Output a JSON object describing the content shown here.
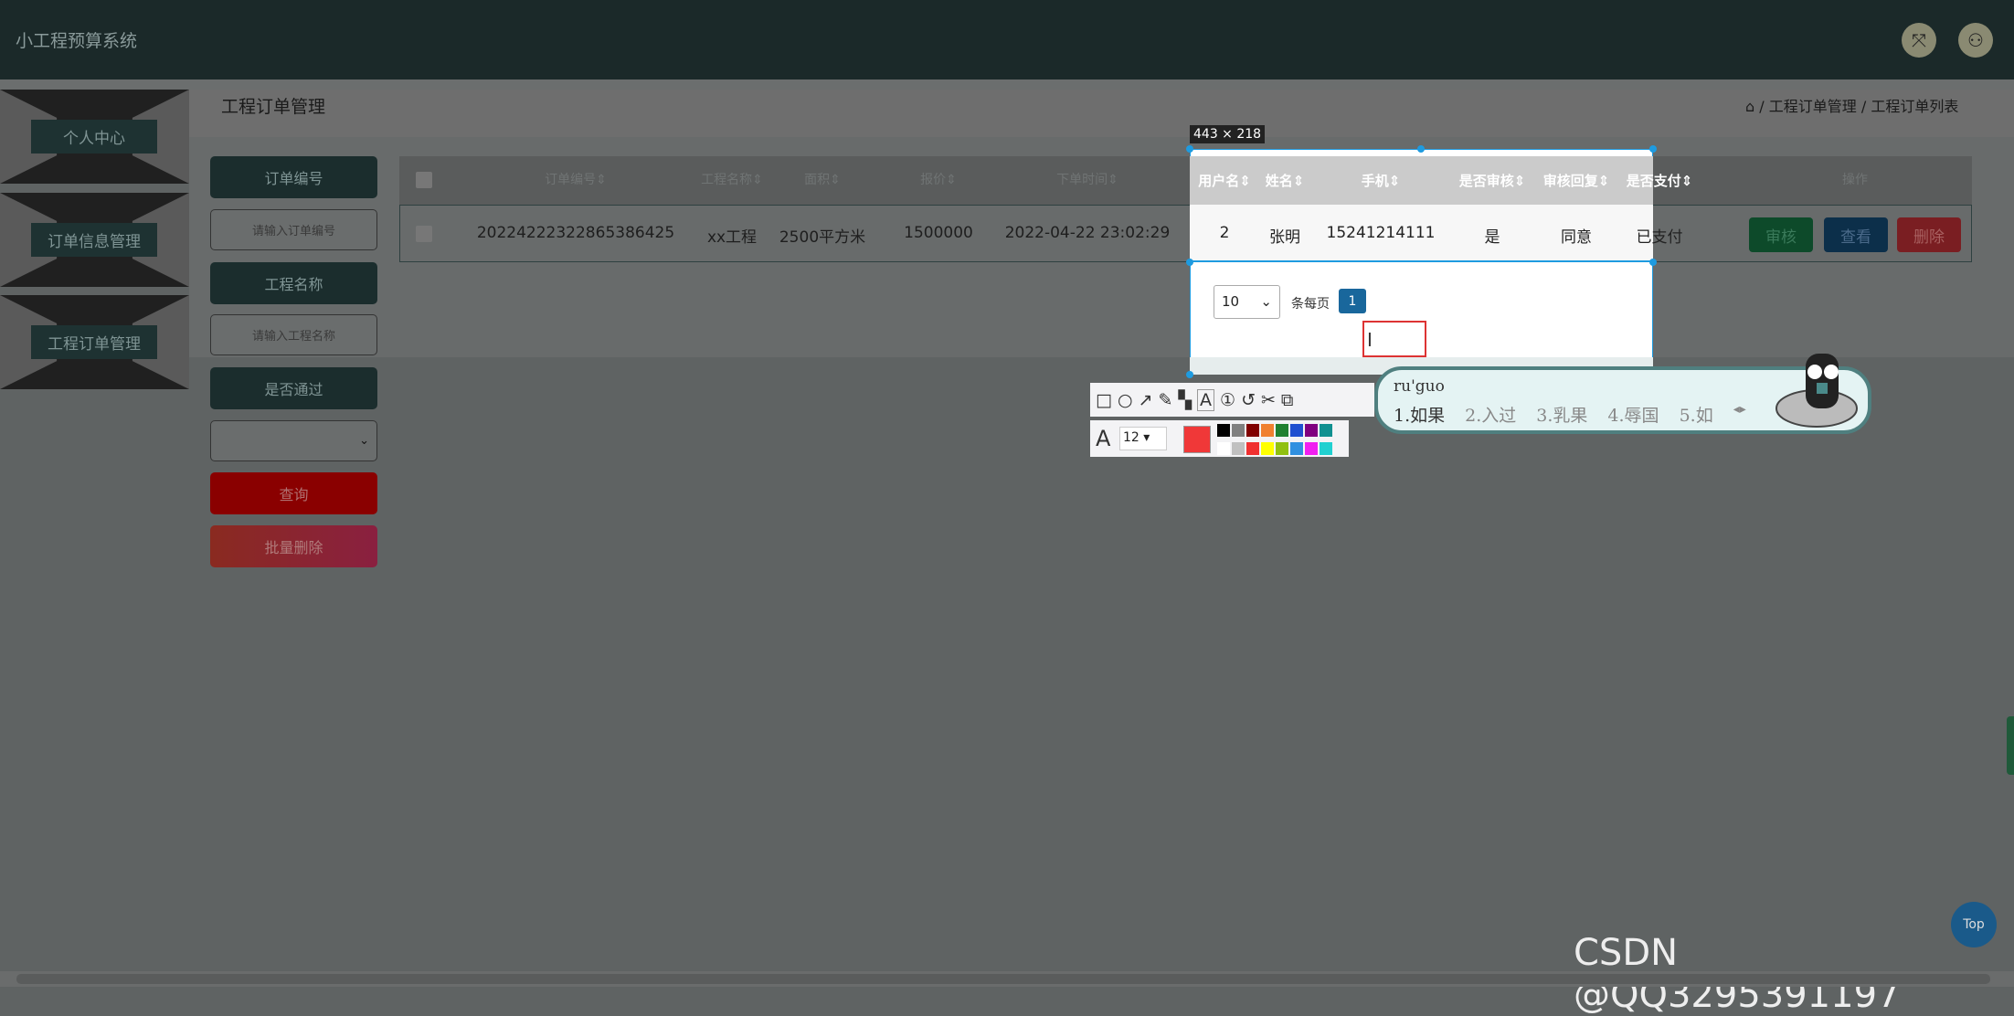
{
  "header": {
    "title": "小工程预算系统",
    "icons": [
      "fullscreen-icon",
      "user-icon"
    ]
  },
  "sidebar": {
    "items": [
      {
        "label": "个人中心"
      },
      {
        "label": "订单信息管理"
      },
      {
        "label": "工程订单管理"
      }
    ]
  },
  "page": {
    "title": "工程订单管理",
    "breadcrumb": [
      "工程订单管理",
      "工程订单列表"
    ],
    "breadcrumb_sep": "/",
    "home_icon": "home-icon"
  },
  "filters": {
    "order_no_label": "订单编号",
    "order_no_placeholder": "请输入订单编号",
    "project_label": "工程名称",
    "project_placeholder": "请输入工程名称",
    "passed_label": "是否通过",
    "passed_value": "",
    "search_button": "查询",
    "batch_delete_button": "批量删除"
  },
  "table": {
    "columns": [
      "订单编号",
      "工程名称",
      "面积",
      "报价",
      "下单时间",
      "用户名",
      "姓名",
      "手机",
      "是否审核",
      "审核回复",
      "是否支付",
      "操作"
    ],
    "rows": [
      {
        "order_no": "20224222322865386425",
        "project": "xx工程",
        "area": "2500平方米",
        "price": "1500000",
        "time": "2022-04-22 23:02:29",
        "username": "2",
        "name": "张明",
        "phone": "15241214111",
        "reviewed": "是",
        "reply": "同意",
        "paid": "已支付"
      }
    ],
    "actions": {
      "review": "审核",
      "view": "查看",
      "delete": "删除"
    },
    "action_colors": {
      "review": "#0d4a2a",
      "view": "#0c2f4a",
      "delete": "#7a1e22"
    }
  },
  "pagination": {
    "page_size": "10",
    "page_size_label": "条每页",
    "current_page": "1"
  },
  "capture": {
    "size_label": "443 × 218",
    "font_size": "12",
    "colors": [
      "#000000",
      "#808080",
      "#800000",
      "#f08030",
      "#208030",
      "#2050d0",
      "#800080",
      "#109090",
      "#ffffff",
      "#c0c0c0",
      "#f03030",
      "#ffff00",
      "#90c010",
      "#3090e0",
      "#f020f0",
      "#20d0d0"
    ],
    "current_color": "#f03838"
  },
  "ime": {
    "pinyin": "ru'guo",
    "candidates": [
      "1.如果",
      "2.入过",
      "3.乳果",
      "4.辱国",
      "5.如"
    ]
  },
  "watermark": "CSDN @QQ3295391197",
  "top_button": "Top"
}
